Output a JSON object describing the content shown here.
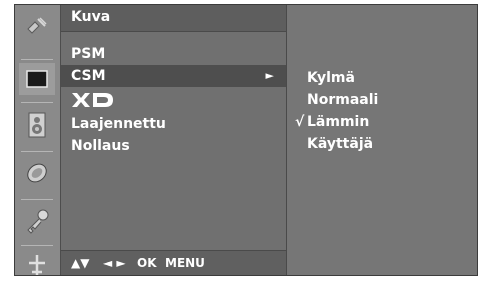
{
  "menu": {
    "title": "Kuva",
    "items": [
      {
        "label": "PSM"
      },
      {
        "label": "CSM",
        "selected_arrow": "►"
      },
      {
        "label": "XD",
        "logo": "xd-logo"
      },
      {
        "label": "Laajennettu"
      },
      {
        "label": "Nollaus"
      }
    ],
    "footer": {
      "updown": "▲▼",
      "leftright": "◄ ►",
      "ok": "OK",
      "menu": "MENU"
    }
  },
  "submenu": {
    "items": [
      {
        "label": "Kylmä",
        "check": ""
      },
      {
        "label": "Normaali",
        "check": ""
      },
      {
        "label": "Lämmin",
        "check": "√"
      },
      {
        "label": "Käyttäjä",
        "check": ""
      }
    ]
  },
  "sidebar_icons": [
    "satellite-icon",
    "picture-icon",
    "speaker-icon",
    "clock-icon",
    "key-icon",
    "airplane-icon"
  ],
  "colors": {
    "frame": "#6e6e6e",
    "highlight": "#4e4e4e",
    "text": "#ffffff"
  }
}
